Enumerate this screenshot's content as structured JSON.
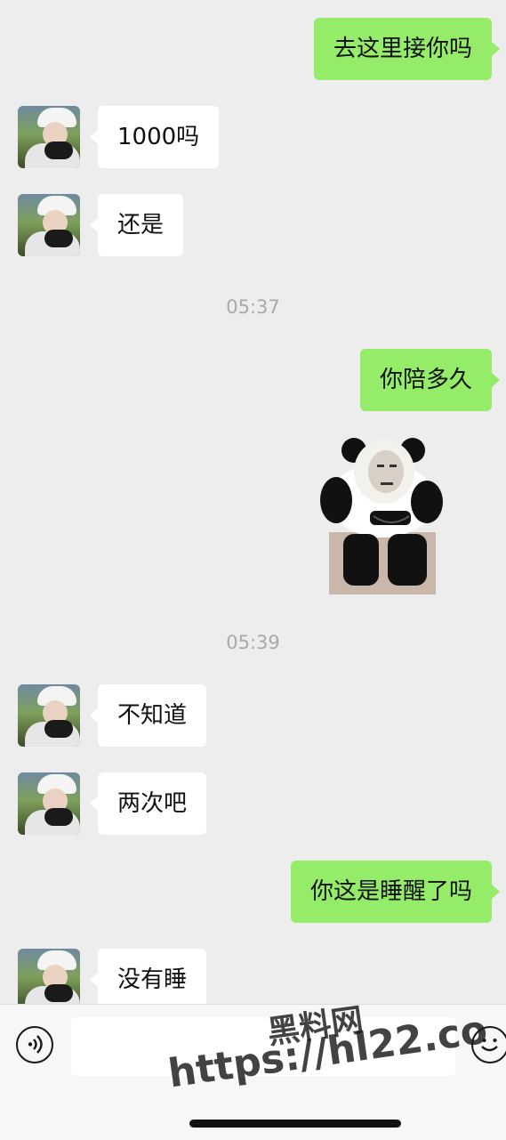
{
  "messages": [
    {
      "id": "m1",
      "side": "right",
      "text": "去这里接你吗"
    },
    {
      "id": "m2",
      "side": "left",
      "text": "1000吗"
    },
    {
      "id": "m3",
      "side": "left",
      "text": "还是"
    },
    {
      "id": "t1",
      "type": "time",
      "text": "05:37"
    },
    {
      "id": "m4",
      "side": "right",
      "text": "你陪多久"
    },
    {
      "id": "m5",
      "side": "right",
      "type": "sticker",
      "icon": "panda-meme-sticker"
    },
    {
      "id": "t2",
      "type": "time",
      "text": "05:39"
    },
    {
      "id": "m6",
      "side": "left",
      "text": "不知道"
    },
    {
      "id": "m7",
      "side": "left",
      "text": "两次吧"
    },
    {
      "id": "m8",
      "side": "right",
      "text": "你这是睡醒了吗"
    },
    {
      "id": "m9",
      "side": "left",
      "text": "没有睡"
    }
  ],
  "inputbar": {
    "value": "",
    "voice_icon": "voice-icon",
    "emoji_icon": "emoji-icon"
  },
  "watermark": {
    "line1": "黑料网",
    "line2": "https://hl22.co"
  },
  "colors": {
    "background": "#ededed",
    "bubble_self": "#95ec69",
    "bubble_other": "#ffffff",
    "timestamp": "#a9a9a9"
  }
}
